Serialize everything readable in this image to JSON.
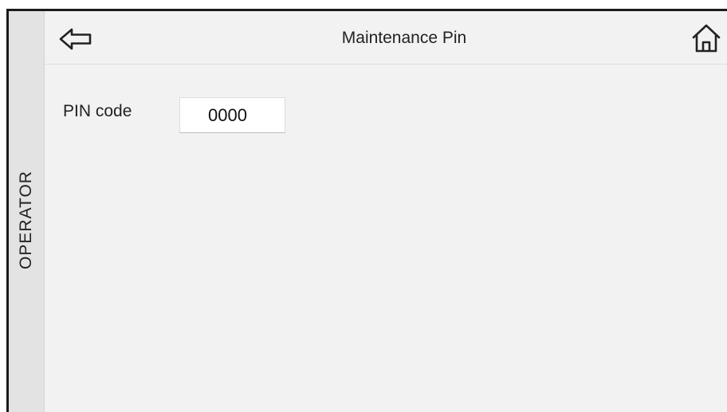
{
  "side_tab": {
    "label": "OPERATOR"
  },
  "header": {
    "title": "Maintenance Pin",
    "back_icon": "arrow-left-outline-icon",
    "home_icon": "home-outline-icon"
  },
  "form": {
    "pin_label": "PIN code",
    "pin_value": "0000"
  },
  "colors": {
    "background": "#f2f2f2",
    "side_tab": "#e3e3e3",
    "border": "#1b1b1b",
    "input_background": "#ffffff"
  }
}
